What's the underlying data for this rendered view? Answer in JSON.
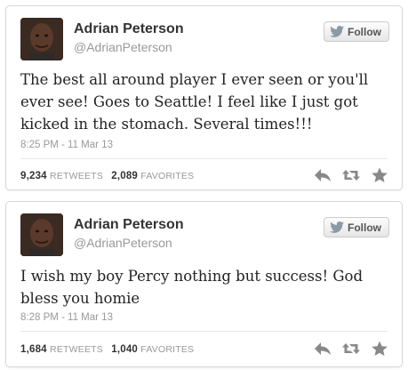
{
  "tweets": [
    {
      "name": "Adrian Peterson",
      "handle": "@AdrianPeterson",
      "follow_label": "Follow",
      "text": "The best all around player I ever seen or you'll ever see! Goes to Seattle! I feel like I just got kicked in the stomach. Several times!!!",
      "timestamp": "8:25 PM - 11 Mar 13",
      "retweets": "9,234",
      "retweets_label": "Retweets",
      "favorites": "2,089",
      "favorites_label": "Favorites"
    },
    {
      "name": "Adrian Peterson",
      "handle": "@AdrianPeterson",
      "follow_label": "Follow",
      "text": "I wish my boy Percy nothing but success! God bless you homie",
      "timestamp": "8:28 PM - 11 Mar 13",
      "retweets": "1,684",
      "retweets_label": "Retweets",
      "favorites": "1,040",
      "favorites_label": "Favorites"
    }
  ],
  "icons": {
    "follow": "bird-icon",
    "reply": "reply-icon",
    "retweet": "retweet-icon",
    "favorite": "star-icon"
  },
  "colors": {
    "icon_gray": "#888888",
    "count_text": "#333333",
    "meta_text": "#999999"
  }
}
